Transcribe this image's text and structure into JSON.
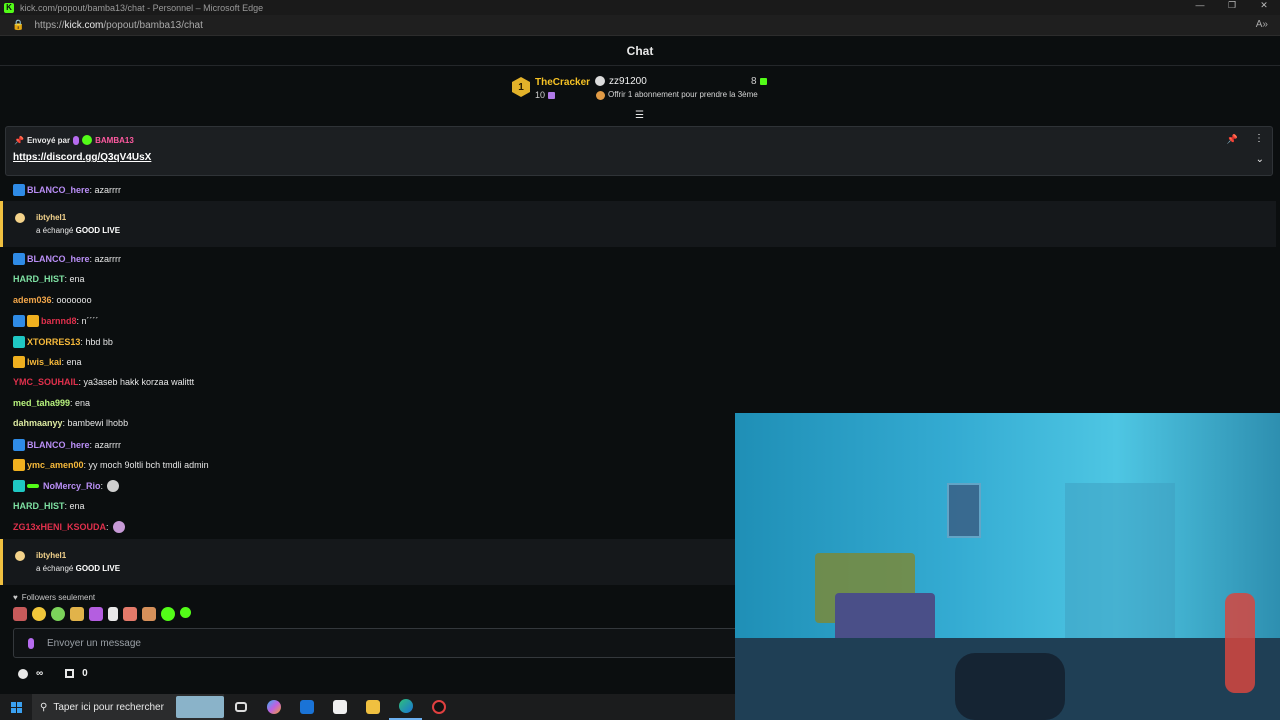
{
  "browser": {
    "title": "kick.com/popout/bamba13/chat - Personnel – Microsoft Edge",
    "url_prefix": "https://",
    "url_host": "kick.com",
    "url_path": "/popout/bamba13/chat",
    "brand_color": "#53fc18"
  },
  "chat": {
    "title": "Chat",
    "leaderboard": {
      "rank": "1",
      "first_name": "TheCracker",
      "first_count": "10",
      "second_name": "zz91200",
      "second_count": "8",
      "subscribe_prompt": "Offrir 1 abonnement pour prendre la 3ème"
    },
    "pinned": {
      "sent_by_label": "Envoyé par",
      "sender": "BAMBA13",
      "link": "https://discord.gg/Q3qV4UsX"
    },
    "messages": [
      {
        "user": "BLANCO_here",
        "text": ": azarrrr",
        "color": "#b98ef5",
        "badges": [
          "og"
        ]
      },
      {
        "user": "BLANCO_here",
        "text": ": azarrrr",
        "color": "#b98ef5",
        "badges": [
          "og"
        ]
      },
      {
        "user": "HARD_HIST",
        "text": ": ena",
        "color": "#7ee0a2",
        "badges": []
      },
      {
        "user": "adem036",
        "text": ": ooooooo",
        "color": "#f2a64a",
        "badges": []
      },
      {
        "user": "barnnd8",
        "text": ": n´´´´",
        "color": "#e0304c",
        "badges": [
          "og",
          "crown"
        ]
      },
      {
        "user": "XTORRES13",
        "text": ": hbd bb",
        "color": "#f6b93b",
        "badges": [
          "gift"
        ]
      },
      {
        "user": "lwis_kai",
        "text": ": ena",
        "color": "#f6b93b",
        "badges": [
          "crown"
        ]
      },
      {
        "user": "YMC_SOUHAIL",
        "text": ": ya3aseb hakk korzaa walittt",
        "color": "#e0304c",
        "badges": []
      },
      {
        "user": "med_taha999",
        "text": ": ena",
        "color": "#b7f27d",
        "badges": []
      },
      {
        "user": "dahmaanyy",
        "text": ": bambewi lhobb",
        "color": "#dce9a1",
        "badges": []
      },
      {
        "user": "BLANCO_here",
        "text": ": azarrrr",
        "color": "#b98ef5",
        "badges": [
          "og"
        ]
      },
      {
        "user": "ymc_amen00",
        "text": ": yy moch 9oltli bch tmdli admin",
        "color": "#f6b93b",
        "badges": [
          "crown"
        ]
      },
      {
        "user": "NoMercy_Rio",
        "text": ":",
        "color": "#b98ef5",
        "badges": [
          "gift",
          "bar"
        ]
      },
      {
        "user": "HARD_HIST",
        "text": ": ena",
        "color": "#7ee0a2",
        "badges": []
      },
      {
        "user": "ZG13xHENI_KSOUDA",
        "text": ":",
        "color": "#e0304c",
        "badges": []
      }
    ],
    "redeems": [
      {
        "user": "ibtyhel1",
        "prefix": "a échangé ",
        "reward": "GOOD LIVE"
      },
      {
        "user": "ibtyhel1",
        "prefix": "a échangé ",
        "reward": "GOOD LIVE"
      }
    ],
    "followers_only": "Followers seulement",
    "input_placeholder": "Envoyer un message",
    "points_value": "∞",
    "box_count": "0"
  },
  "taskbar": {
    "search_placeholder": "Taper ici pour rechercher"
  }
}
